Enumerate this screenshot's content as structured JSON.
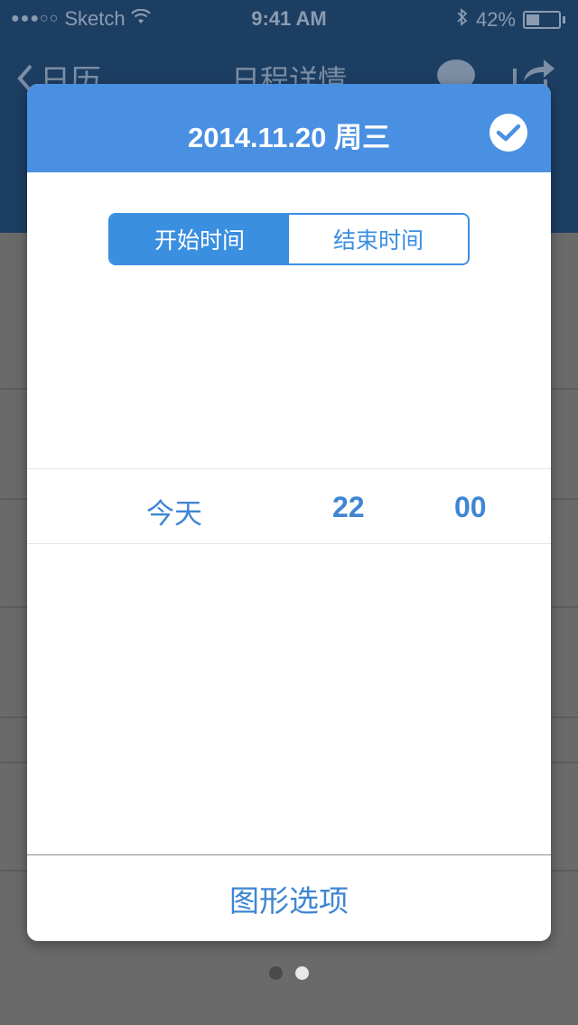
{
  "status_bar": {
    "carrier": "Sketch",
    "time": "9:41 AM",
    "battery": "42%",
    "battery_level": 0.42
  },
  "nav": {
    "back_label": "日历",
    "title": "日程详情"
  },
  "modal": {
    "title": "2014.11.20  周三",
    "segments": [
      "开始时间",
      "结束时间"
    ],
    "selected_segment": "开始时间",
    "picker": {
      "day": "今天",
      "hour": "22",
      "minute": "00"
    },
    "footer_label": "图形选项"
  },
  "pagination": {
    "count": 2,
    "active_index": 1
  },
  "colors": {
    "accent": "#4a90e2",
    "segment_blue": "#3a8fe0",
    "picker_text": "#3f86d2",
    "header_bg": "#1d3e63"
  }
}
